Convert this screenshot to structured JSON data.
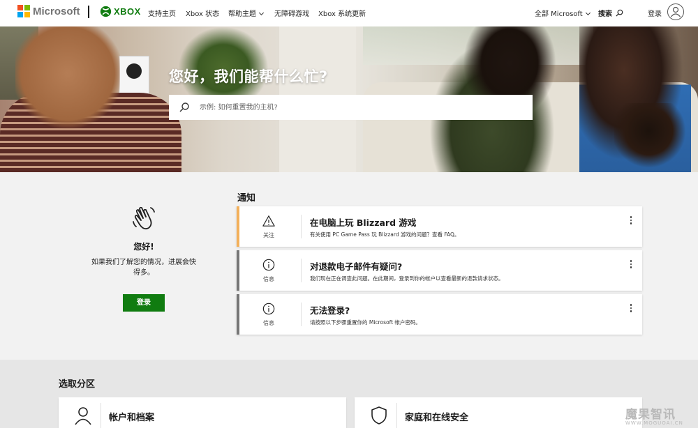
{
  "header": {
    "brand": "Microsoft",
    "product": "XBOX",
    "nav": [
      "支持主页",
      "Xbox 状态",
      "帮助主题",
      "无障碍游戏",
      "Xbox 系统更新"
    ],
    "all_microsoft": "全部 Microsoft",
    "search_label": "搜索",
    "signin_label": "登录"
  },
  "hero": {
    "title": "您好，我们能帮什么忙?",
    "search_placeholder": "示例: 如何重置我的主机?"
  },
  "greeting": {
    "title": "您好!",
    "subtitle": "如果我们了解您的情况，进展会快得多。",
    "button": "登录"
  },
  "notifications": {
    "heading": "通知",
    "items": [
      {
        "kind": "关注",
        "icon": "warning-icon",
        "title": "在电脑上玩 Blizzard 游戏",
        "desc": "有关使用 PC Game Pass 玩 Blizzard 游戏的问题？查看 FAQ。"
      },
      {
        "kind": "信息",
        "icon": "info-icon",
        "title": "对退款电子邮件有疑问?",
        "desc": "我们现在正在调查此问题。在此期间，登录到你的帐户以查看最新的退款请求状态。"
      },
      {
        "kind": "信息",
        "icon": "info-icon",
        "title": "无法登录?",
        "desc": "请按照以下步骤重置你的 Microsoft 帐户密码。"
      }
    ]
  },
  "categories": {
    "heading": "选取分区",
    "items": [
      {
        "label": "帐户和档案",
        "icon": "person-icon"
      },
      {
        "label": "家庭和在线安全",
        "icon": "shield-icon"
      }
    ]
  },
  "watermark": {
    "text": "魔果智讯",
    "sub": "WWW.MOGUOAI.CN"
  },
  "colors": {
    "accent": "#107c10",
    "warning": "#f3b05a",
    "info": "#767676"
  }
}
